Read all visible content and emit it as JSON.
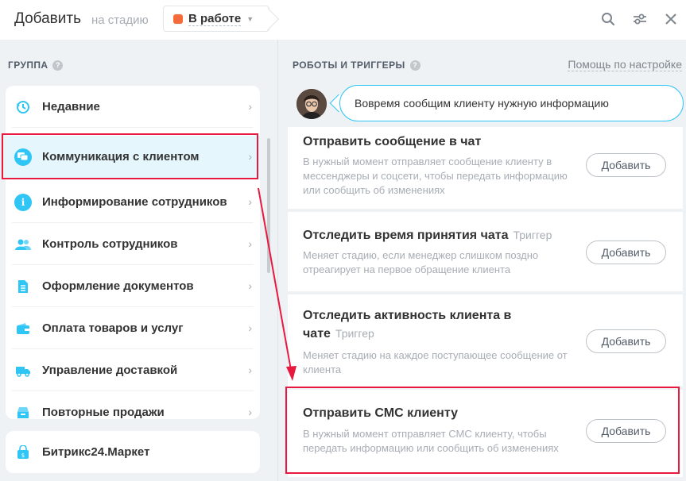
{
  "header": {
    "title": "Добавить",
    "stage_label": "на стадию",
    "stage_value": "В работе",
    "stage_color": "#f46a3b"
  },
  "left": {
    "section_title": "ГРУППА",
    "groups": [
      {
        "label": "Недавние",
        "icon": "recent-icon",
        "color": "#2fc6f6"
      },
      {
        "label": "Коммуникация с клиентом",
        "icon": "chat-icon",
        "color": "#2fc6f6"
      },
      {
        "label": "Информирование сотрудников",
        "icon": "info-icon",
        "color": "#2fc6f6"
      },
      {
        "label": "Контроль сотрудников",
        "icon": "users-icon",
        "color": "#2fc6f6"
      },
      {
        "label": "Оформление документов",
        "icon": "document-icon",
        "color": "#2fc6f6"
      },
      {
        "label": "Оплата товаров и услуг",
        "icon": "wallet-icon",
        "color": "#2fc6f6"
      },
      {
        "label": "Управление доставкой",
        "icon": "truck-icon",
        "color": "#2fc6f6"
      },
      {
        "label": "Повторные продажи",
        "icon": "repeat-icon",
        "color": "#2fc6f6"
      }
    ],
    "market_label": "Битрикс24.Маркет"
  },
  "right": {
    "section_title": "РОБОТЫ И ТРИГГЕРЫ",
    "help_link": "Помощь по настройке",
    "bubble_text": "Вовремя сообщим клиенту нужную информацию",
    "cards": [
      {
        "title": "Отправить сообщение в чат",
        "tag": "",
        "desc": "В нужный момент отправляет сообщение клиенту в мессенджеры и соцсети, чтобы передать информацию или сообщить об изменениях",
        "button": "Добавить"
      },
      {
        "title": "Отследить время принятия чата",
        "tag": "Триггер",
        "desc": "Меняет стадию, если менеджер слишком поздно отреагирует на первое обращение клиента",
        "button": "Добавить"
      },
      {
        "title": "Отследить активность клиента в чате",
        "tag": "Триггер",
        "desc": "Меняет стадию на каждое поступающее сообщение от клиента",
        "button": "Добавить"
      },
      {
        "title": "Отправить СМС клиенту",
        "tag": "",
        "desc": "В нужный момент отправляет СМС клиенту, чтобы передать информацию или сообщить об изменениях",
        "button": "Добавить"
      }
    ]
  },
  "highlight_color": "#e8183f"
}
